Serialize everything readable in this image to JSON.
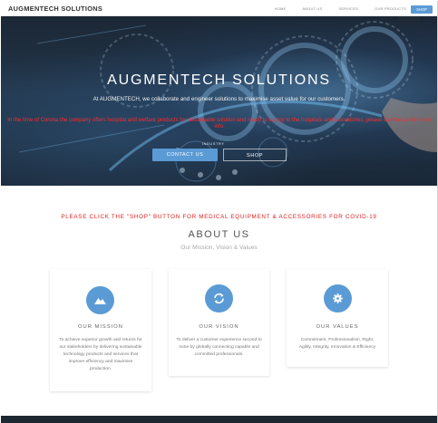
{
  "navbar": {
    "brand": "AUGMENTECH SOLUTIONS",
    "links": [
      "Home",
      "About Us",
      "Services",
      "Our Products"
    ],
    "shop_label": "Shop"
  },
  "hero": {
    "title": "AUGMENTECH SOLUTIONS",
    "subtitle": "At AUGMENTECH, we collaborate and engineer solutions to maximise asset value for our customers.",
    "notice": "In the time of Corona the company offers hospital and welfare products for sustainable solution and ready to supply to the hospitals and laboratories, please Contact us for more info.",
    "small_label": "INDUSTRY",
    "contact_label": "CONTACT US",
    "shop_label": "SHOP"
  },
  "covid_notice": "PLEASE CLICK THE \"SHOP\" BUTTON FOR MEDICAL EQUIPMENT & ACCESSORIES FOR COVID-19",
  "about": {
    "title": "ABOUT US",
    "subtitle": "Our Mission, Vision & Values"
  },
  "cards": [
    {
      "icon": "mountain-icon",
      "title": "OUR MISSION",
      "text": "To achieve superior growth and returns for our stakeholders by delivering sustainable technology products and services that improve efficiency and maximise production."
    },
    {
      "icon": "refresh-icon",
      "title": "OUR VISION",
      "text": "To deliver a customer experience second to none by globally connecting capable and committed professionals."
    },
    {
      "icon": "gear-icon",
      "title": "OUR VALUES",
      "text": "Commitment, Professionalism, Right, Agility, Integrity, Innovation & Efficiency"
    }
  ],
  "colors": {
    "accent": "#5b9bd5",
    "notice_red": "#e02020",
    "hero_dark": "#1b2735"
  }
}
